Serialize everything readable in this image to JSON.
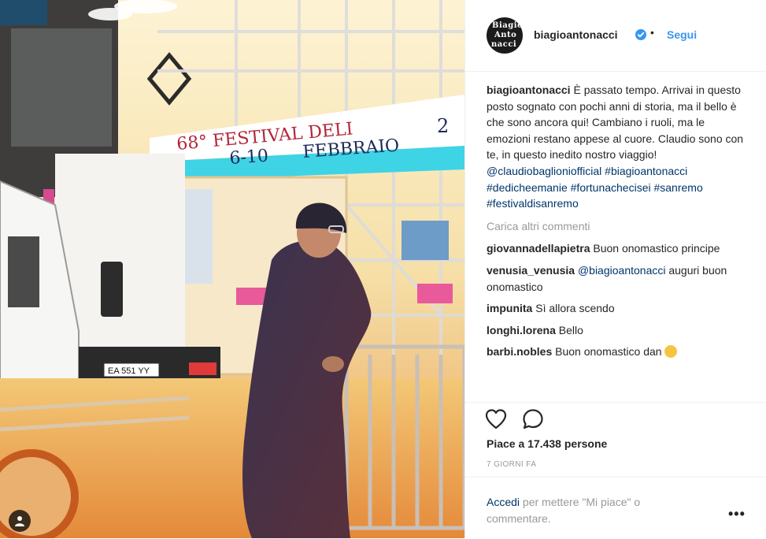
{
  "photo": {
    "sign_line1": "68° FESTIVAL DELI",
    "sign_line2": "6-10",
    "sign_line3": "FEBBRAIO",
    "sign_number": "2",
    "plate": "EA 551 YY"
  },
  "header": {
    "avatar_text": [
      "Biagio",
      "Anto",
      "nacci"
    ],
    "username": "biagioantonacci",
    "separator": "•",
    "follow_label": "Segui"
  },
  "caption": {
    "username": "biagioantonacci",
    "text": "È passato tempo. Arrivai in questo posto sognato con pochi anni di storia, ma il bello è che sono ancora qui! Cambiano i ruoli, ma le emozioni restano appese al cuore. Claudio sono con te, in questo inedito nostro viaggio!",
    "mention": "@claudiobaglionio​fficial",
    "hashtags": [
      "#biagioantonacci",
      "#dedicheemanie",
      "#fortunachecisei",
      "#sanremo",
      "#festivaldisanremo"
    ]
  },
  "load_more": "Carica altri commenti",
  "comments": [
    {
      "user": "giovannadellapietra",
      "text": "Buon onomastico principe"
    },
    {
      "user": "venusia_venusia",
      "mention": "@biagioantonacci",
      "text": "auguri buon onomastico"
    },
    {
      "user": "impunita",
      "text": "Sì allora scendo"
    },
    {
      "user": "longhi.lorena",
      "text": "Bello"
    },
    {
      "user": "barbi.nobles",
      "text": "Buon onomastico dan"
    }
  ],
  "likes": "Piace a 17.438 persone",
  "time": "7 GIORNI FA",
  "login": {
    "link": "Accedi",
    "text": " per mettere \"Mi piace\" o commentare."
  },
  "more_label": "•••",
  "colors": {
    "accent": "#3897f0",
    "hashtag": "#003569",
    "muted": "#999999"
  }
}
